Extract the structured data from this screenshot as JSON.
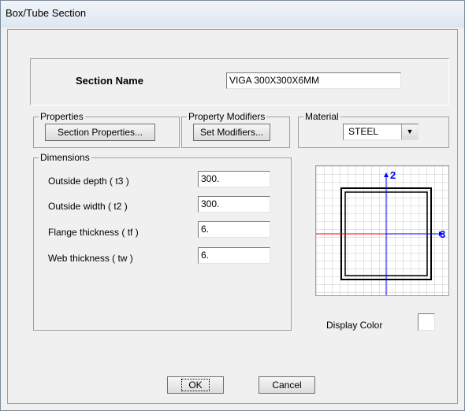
{
  "window": {
    "title": "Box/Tube Section"
  },
  "section_name": {
    "label": "Section Name",
    "value": "VIGA 300X300X6MM"
  },
  "properties": {
    "label": "Properties",
    "button": "Section Properties..."
  },
  "property_modifiers": {
    "label": "Property Modifiers",
    "button": "Set Modifiers..."
  },
  "material": {
    "label": "Material",
    "value": "STEEL"
  },
  "dimensions": {
    "label": "Dimensions",
    "rows": [
      {
        "label": "Outside depth  ( t3 )",
        "value": "300."
      },
      {
        "label": "Outside width  ( t2 )",
        "value": "300."
      },
      {
        "label": "Flange thickness  ( tf )",
        "value": "6."
      },
      {
        "label": "Web thickness  ( tw )",
        "value": "6."
      }
    ]
  },
  "preview": {
    "axis_2": "2",
    "axis_3": "3",
    "axis_vertical_color": "#0000ff",
    "axis_horizontal_color": "#ff0000"
  },
  "display_color": {
    "label": "Display Color",
    "swatch": "#ffffff"
  },
  "buttons": {
    "ok": "OK",
    "cancel": "Cancel"
  }
}
